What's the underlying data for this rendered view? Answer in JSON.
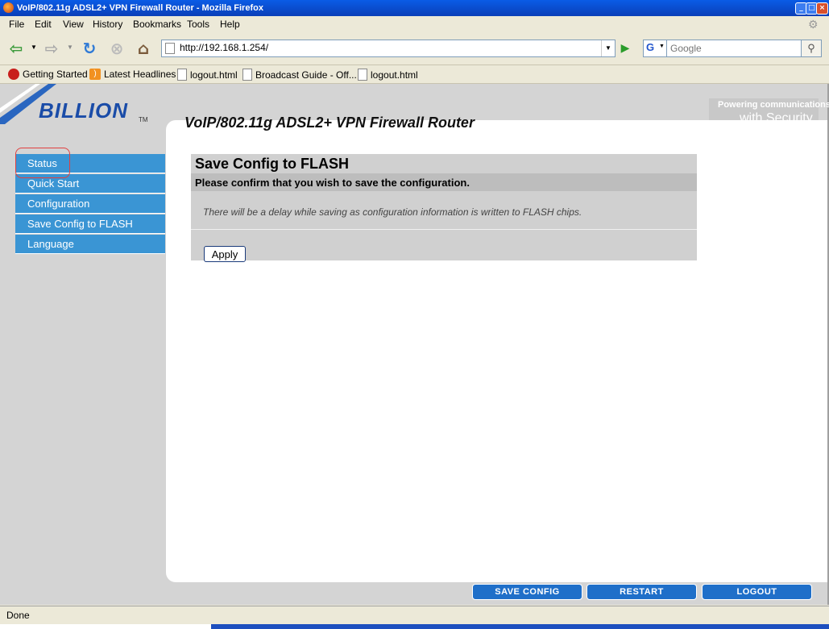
{
  "window": {
    "title": "VoIP/802.11g ADSL2+ VPN Firewall Router - Mozilla Firefox"
  },
  "menubar": {
    "items": [
      "File",
      "Edit",
      "View",
      "History",
      "Bookmarks",
      "Tools",
      "Help"
    ]
  },
  "toolbar": {
    "url": "http://192.168.1.254/",
    "search_engine": "G",
    "search_placeholder": "Google"
  },
  "bookmarks": [
    "Getting Started",
    "Latest Headlines",
    "logout.html",
    "Broadcast Guide - Off...",
    "logout.html"
  ],
  "router": {
    "logo": "BILLION",
    "logo_tm": "TM",
    "title": "VoIP/802.11g ADSL2+ VPN Firewall Router",
    "tagline_line1": "Powering communications",
    "tagline_line2": "with Security"
  },
  "sidebar": {
    "items": [
      "Status",
      "Quick Start",
      "Configuration",
      "Save Config to FLASH",
      "Language"
    ]
  },
  "main": {
    "heading": "Save Config to FLASH",
    "subheading": "Please confirm that you wish to save the configuration.",
    "note": "There will be a delay while saving as configuration information is written to FLASH chips.",
    "apply_label": "Apply"
  },
  "footer_buttons": {
    "save": "SAVE CONFIG",
    "restart": "RESTART",
    "logout": "LOGOUT"
  },
  "statusbar": {
    "text": "Done"
  },
  "colors": {
    "nav_blue": "#3a95d4",
    "button_blue": "#1f6fc9",
    "logo_blue": "#1a4ca8",
    "highlight_ring": "#e04040"
  }
}
